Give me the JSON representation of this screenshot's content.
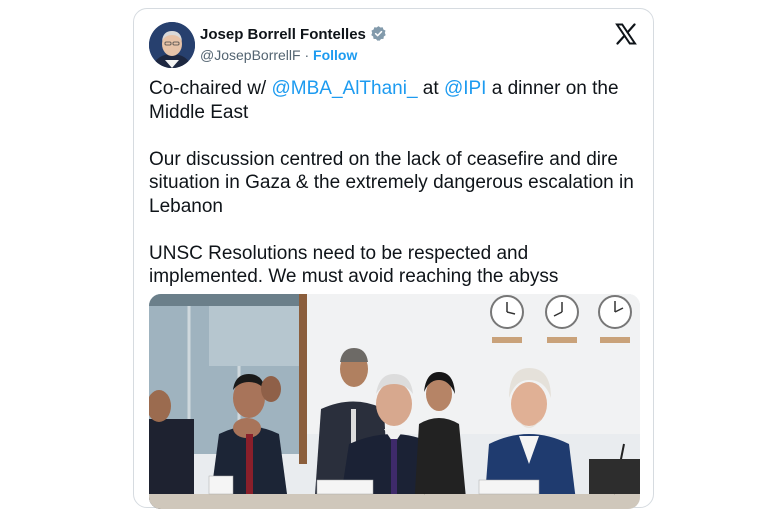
{
  "author": {
    "name": "Josep Borrell Fontelles",
    "handle": "@JosepBorrellF",
    "separator": "·",
    "follow_label": "Follow",
    "verified": true
  },
  "tweet": {
    "p1": {
      "pre": "Co-chaired w/ ",
      "mention1": "@MBA_AlThani_",
      "mid": " at ",
      "mention2": "@IPI",
      "post": " a dinner on the Middle East"
    },
    "p2": "Our discussion centred on the lack of ceasefire and dire situation in Gaza & the extremely dangerous escalation in Lebanon",
    "p3": "UNSC Resolutions need to be respected and implemented. We must avoid reaching the abyss"
  },
  "icons": {
    "brand": "x-logo-icon",
    "verified": "verified-badge-icon"
  },
  "colors": {
    "link": "#1d9bf0",
    "text": "#0f1419",
    "secondary": "#536471",
    "border": "#d6dbe0"
  }
}
